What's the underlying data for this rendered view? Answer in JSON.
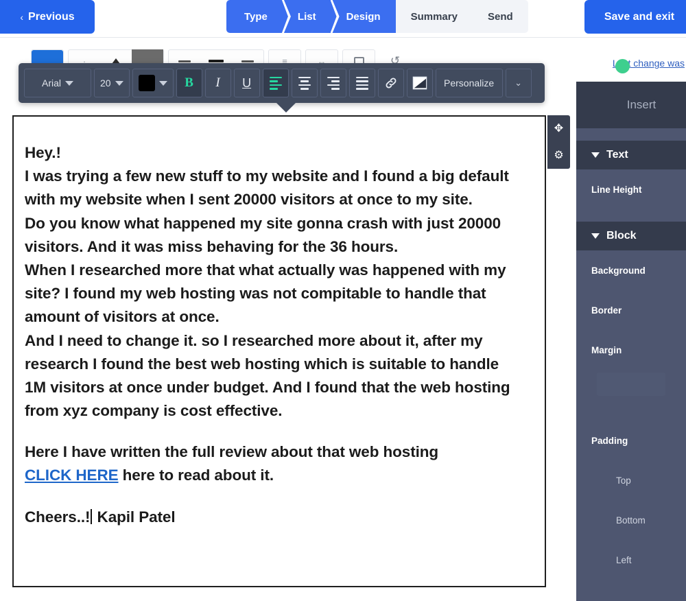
{
  "topbar": {
    "previous_label": "Previous",
    "previous_chevron": "‹",
    "save_label": "Save and exit",
    "steps": [
      {
        "label": "Type",
        "state": "done"
      },
      {
        "label": "List",
        "state": "done"
      },
      {
        "label": "Design",
        "state": "done"
      },
      {
        "label": "Summary",
        "state": "todo"
      },
      {
        "label": "Send",
        "state": "todo"
      }
    ]
  },
  "status": {
    "last_change_label": "Last change was",
    "cursor_color": "#3ecf8e"
  },
  "format_toolbar": {
    "font_family": "Arial",
    "font_size": "20",
    "text_color": "#000000",
    "bold_label": "B",
    "bold_active": true,
    "italic_label": "I",
    "underline_label": "U",
    "align_left_active": true,
    "link_icon": "link-icon",
    "image_icon": "image-icon",
    "personalize_label": "Personalize",
    "more_label": "chevron-down-icon"
  },
  "block_tools": {
    "move_icon": "✥",
    "settings_icon": "⚙"
  },
  "email_body": {
    "lines": [
      "Hey.!",
      "I was trying a few new stuff to my website and I found a big default with my website when I sent 20000 visitors at once to my site.",
      "Do you know what happened my site gonna crash with just 20000 visitors. And it was miss behaving for the 36 hours.",
      "When I researched more that what actually was happened with my site? I found my web hosting was not compitable to handle that amount of visitors at once.",
      "And I need to change it. so I researched more about it, after my research I found the best web hosting which is suitable to handle 1M visitors at once under budget. And I found that the web hosting from xyz company is cost effective."
    ],
    "para_review": "Here I have written the full review about that web hosting",
    "link_text": "CLICK HERE",
    "after_link_text": " here to read about it.",
    "signature_before": "Cheers..!",
    "signature_after": " Kapil Patel"
  },
  "sidebar": {
    "tab_label": "Insert",
    "sections": [
      {
        "title": "Text",
        "rows": [
          {
            "label": "Line Height",
            "type": "row"
          }
        ]
      },
      {
        "title": "Block",
        "rows": [
          {
            "label": "Background",
            "type": "row"
          },
          {
            "label": "Border",
            "type": "row"
          },
          {
            "label": "Margin",
            "type": "row"
          },
          {
            "label": "Padding",
            "type": "row"
          },
          {
            "label": "Top",
            "type": "sub"
          },
          {
            "label": "Bottom",
            "type": "sub"
          },
          {
            "label": "Left",
            "type": "sub"
          }
        ]
      }
    ]
  },
  "background_toolbar": {
    "items": [
      "color-swatch",
      "indent-stepper",
      "align-group",
      "spacing",
      "link",
      "image",
      "undo"
    ]
  },
  "colors": {
    "primary_blue": "#2563eb",
    "step_blue": "#3b6ef0",
    "toolbar_dark": "#414b5e",
    "sidebar": "#4e5670",
    "sidebar_header": "#343b4c",
    "accent_green": "#27d8a0",
    "link_blue": "#1e66c9"
  }
}
